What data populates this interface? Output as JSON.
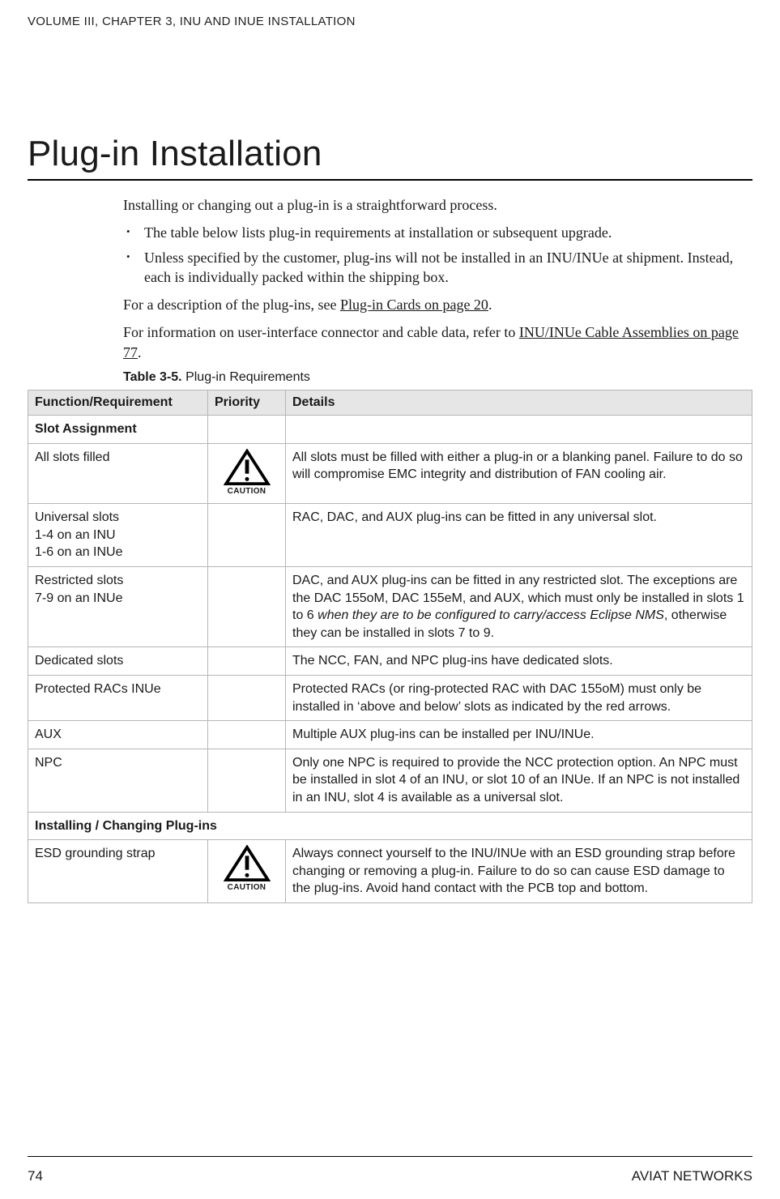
{
  "header": "VOLUME III, CHAPTER 3, INU AND INUE INSTALLATION",
  "title": "Plug-in Installation",
  "intro": "Installing or changing out a plug-in is a straightforward process.",
  "bullets": [
    "The table below lists plug-in requirements at installation or subsequent upgrade.",
    "Unless specified by the customer, plug-ins will not be installed in an INU/INUe at shipment. Instead, each is individually packed within the shipping box."
  ],
  "para_desc_pre": "For a description of the plug-ins, see ",
  "para_desc_link": "Plug-in Cards on page 20",
  "para_desc_post": ".",
  "para_cable_pre": "For information on user-interface connector and cable data, refer to ",
  "para_cable_link": "INU/INUe Cable Assemblies on page 77",
  "para_cable_post": ".",
  "table_caption_bold": "Table 3-5.",
  "table_caption_rest": " Plug-in Requirements",
  "th_func": "Function/Requirement",
  "th_pri": "Priority",
  "th_det": "Details",
  "caution_label": "CAUTION",
  "rows": {
    "slot_section": "Slot Assignment",
    "allslots": {
      "func": "All slots filled",
      "det": "All slots must be filled with either a plug-in or a blanking panel. Failure to do so will compromise EMC integrity and distribution of FAN cooling air."
    },
    "universal": {
      "func_l1": "Universal slots",
      "func_l2": "1-4 on an INU",
      "func_l3": "1-6 on an INUe",
      "det": "RAC, DAC, and AUX plug-ins can be fitted in any universal slot."
    },
    "restricted": {
      "func_l1": "Restricted slots",
      "func_l2": "7-9 on an INUe",
      "det_pre": "DAC, and AUX plug-ins can be fitted in any restricted slot. The exceptions are the DAC 155oM, DAC 155eM, and AUX, which must only be installed in slots 1 to 6 ",
      "det_em": "when they are to be configured to carry/access Eclipse NMS",
      "det_post": ", otherwise they can be installed in slots 7 to 9."
    },
    "dedicated": {
      "func": "Dedicated slots",
      "det": "The NCC, FAN, and NPC plug-ins have dedicated slots."
    },
    "protected": {
      "func": "Protected RACs INUe",
      "det": "Protected RACs (or ring-protected RAC with DAC 155oM) must only be installed in ‘above and below’ slots as indicated by the red arrows."
    },
    "aux": {
      "func": "AUX",
      "det": "Multiple AUX plug-ins can be installed per INU/INUe."
    },
    "npc": {
      "func": "NPC",
      "det": "Only one NPC is required to provide the NCC protection option. An NPC must be installed in slot 4 of an INU, or slot 10 of an INUe. If an NPC is not installed in an INU, slot 4 is available as a universal slot."
    },
    "install_section": "Installing / Changing Plug-ins",
    "esd": {
      "func": "ESD grounding strap",
      "det": "Always connect yourself to the INU/INUe with an ESD grounding strap before changing or removing a plug-in. Failure to do so can cause ESD damage to the plug-ins. Avoid hand contact with the PCB top and bottom."
    }
  },
  "footer": {
    "page": "74",
    "brand": "AVIAT NETWORKS"
  }
}
